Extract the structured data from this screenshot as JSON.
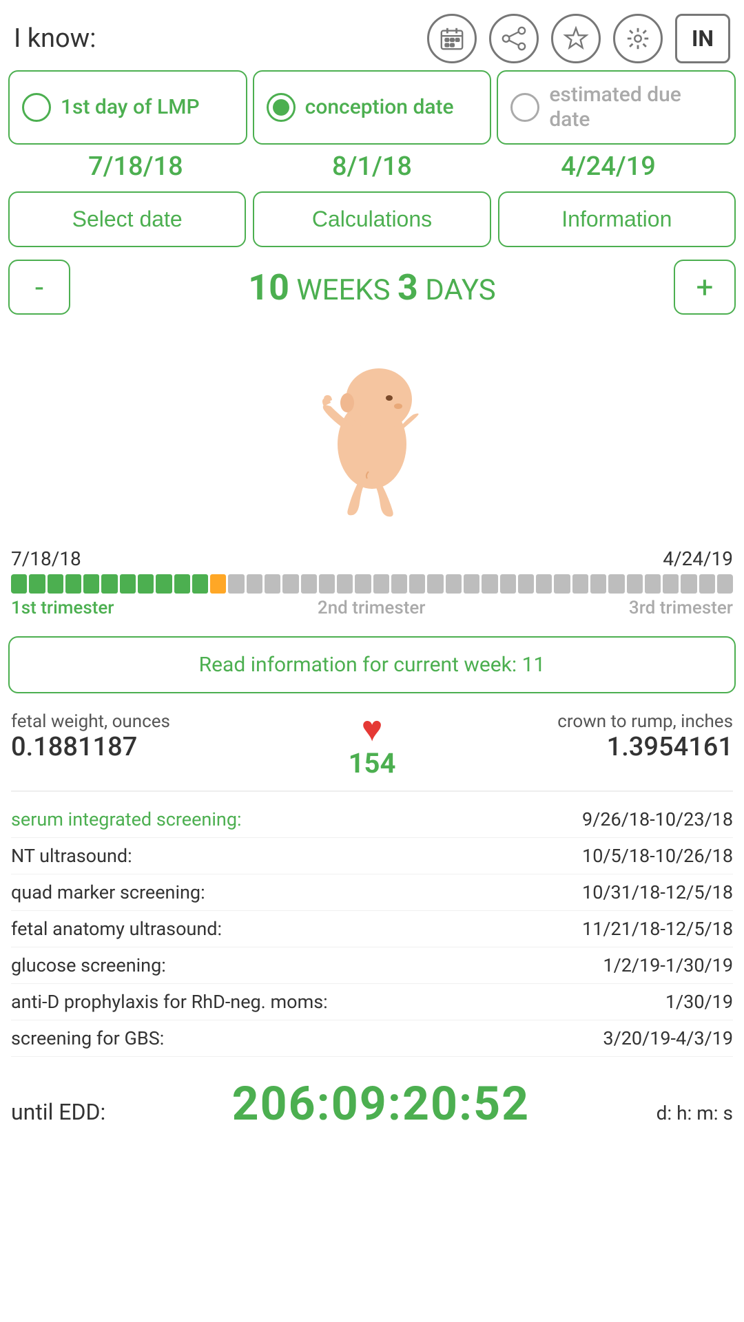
{
  "topBar": {
    "label": "I know:",
    "icons": [
      "calendar-icon",
      "share-icon",
      "star-icon",
      "settings-icon"
    ],
    "inButton": "IN"
  },
  "radioOptions": [
    {
      "label": "1st day of LMP",
      "selected": false
    },
    {
      "label": "conception date",
      "selected": true
    },
    {
      "label": "estimated due date",
      "selected": false
    }
  ],
  "dates": {
    "lmp": "7/18/18",
    "conception": "8/1/18",
    "edd": "4/24/19"
  },
  "buttons": {
    "selectDate": "Select date",
    "calculations": "Calculations",
    "information": "Information"
  },
  "weekDisplay": {
    "minus": "-",
    "weeks": "10",
    "weeksLabel": " WEEKS ",
    "days": "3",
    "daysLabel": " DAYS",
    "plus": "+"
  },
  "progress": {
    "startDate": "7/18/18",
    "endDate": "4/24/19",
    "filledGreen": 11,
    "filledOrange": 1,
    "totalGray": 28,
    "trimesterLabels": [
      "1st trimester",
      "2nd trimester",
      "3rd trimester"
    ]
  },
  "infoWeekBtn": "Read information for current week: 11",
  "stats": {
    "fetalWeightLabel": "fetal weight, ounces",
    "fetalWeightValue": "0.1881187",
    "heartCount": "154",
    "crownRumpLabel": "crown to rump, inches",
    "crownRumpValue": "1.3954161"
  },
  "screenings": [
    {
      "label": "serum integrated screening:",
      "value": "9/26/18-10/23/18",
      "green": true
    },
    {
      "label": "NT ultrasound:",
      "value": "10/5/18-10/26/18",
      "green": false
    },
    {
      "label": "quad marker screening:",
      "value": "10/31/18-12/5/18",
      "green": false
    },
    {
      "label": "fetal anatomy ultrasound:",
      "value": "11/21/18-12/5/18",
      "green": false
    },
    {
      "label": "glucose screening:",
      "value": "1/2/19-1/30/19",
      "green": false
    },
    {
      "label": "anti-D prophylaxis for RhD-neg. moms:",
      "value": "1/30/19",
      "green": false
    },
    {
      "label": "screening for GBS:",
      "value": "3/20/19-4/3/19",
      "green": false
    }
  ],
  "edd": {
    "label": "until EDD:",
    "countdown": "206:09:20:52",
    "units": "d: h: m: s"
  }
}
